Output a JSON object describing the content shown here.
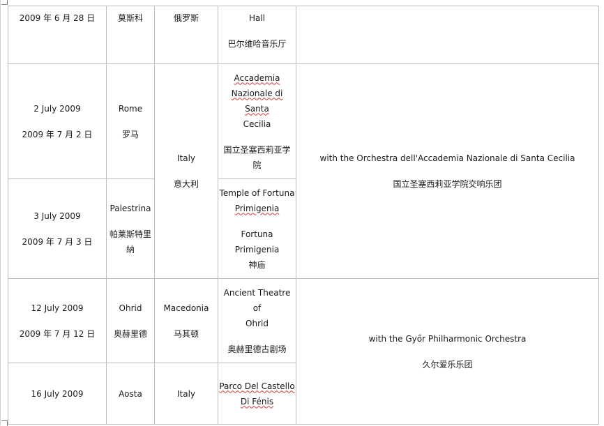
{
  "rows": [
    {
      "date_en": "",
      "date_zh": "2009 年 6 月 28 日",
      "city_en": "",
      "city_zh": "莫斯科",
      "country_en": "",
      "country_zh": "俄罗斯",
      "venue_en": "Hall",
      "venue_zh": "巴尔维哈音乐厅",
      "notes_en": "",
      "notes_zh": ""
    },
    {
      "date_en": "2 July 2009",
      "date_zh": "2009 年 7 月 2 日",
      "city_en": "Rome",
      "city_zh": "罗马",
      "venue_en_parts": [
        "Accademia",
        "Nazionale di Santa",
        "Cecilia"
      ],
      "venue_zh_parts": [
        "国立圣塞西莉亚学",
        "院"
      ]
    },
    {
      "date_en": "3 July 2009",
      "date_zh": "2009 年 7 月 3 日",
      "city_en": "Palestrina",
      "city_zh_parts": [
        "帕莱斯特里",
        "納"
      ],
      "venue_en_parts": [
        "Temple of Fortuna",
        "Primigenia"
      ],
      "venue_zh_parts": [
        "Fortuna Primigenia",
        "神庙"
      ]
    },
    {
      "date_en": "12 July 2009",
      "date_zh": "2009 年 7 月 12 日",
      "city_en": "Ohrid",
      "city_zh": "奥赫里德",
      "country_en": "Macedonia",
      "country_zh": "马其顿",
      "venue_en_parts": [
        "Ancient Theatre of",
        "Ohrid"
      ],
      "venue_zh": "奥赫里德古剧场"
    },
    {
      "date_en": "16 July 2009",
      "city_en": "Aosta",
      "country_en": "Italy",
      "venue_en_parts": [
        "Parco Del Castello",
        "Di Fénis"
      ]
    }
  ],
  "italy_group": {
    "country_en": "Italy",
    "country_zh": "意大利",
    "notes_en": "with the Orchestra dell'Accademia Nazionale di Santa Cecilia",
    "notes_zh": "国立圣塞西莉亚学院交响乐团"
  },
  "gyor_group": {
    "notes_en": "with the Győr Philharmonic Orchestra",
    "notes_zh": "久尔爱乐乐团"
  }
}
